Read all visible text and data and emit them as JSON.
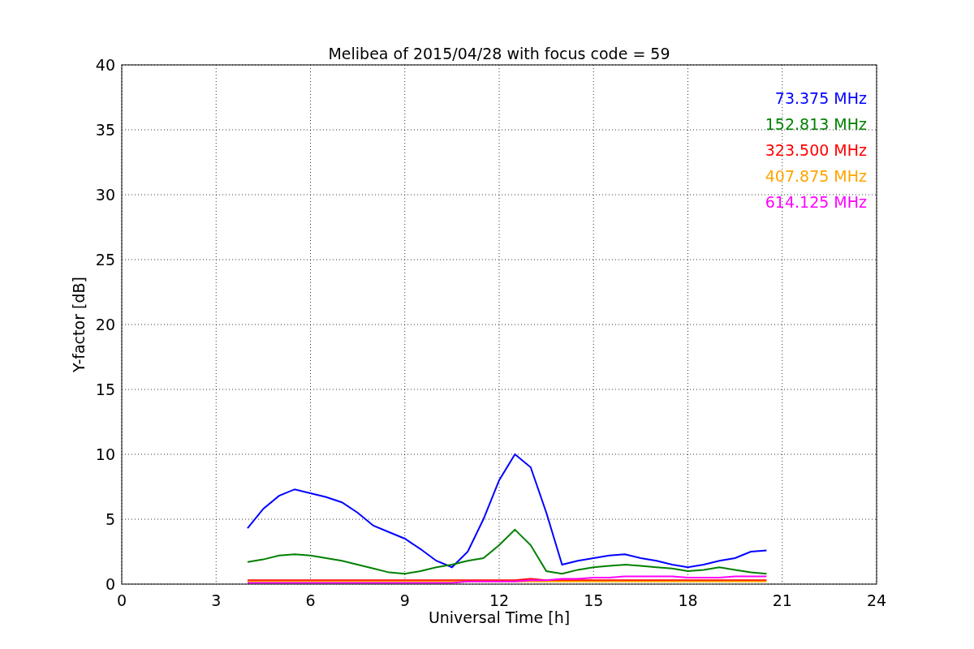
{
  "chart_data": {
    "type": "line",
    "title": "Melibea of 2015/04/28 with focus code = 59",
    "xlabel": "Universal Time [h]",
    "ylabel": "Y-factor [dB]",
    "x": [
      4,
      4.5,
      5,
      5.5,
      6,
      6.5,
      7,
      7.5,
      8,
      8.5,
      9,
      9.5,
      10,
      10.5,
      11,
      11.5,
      12,
      12.5,
      13,
      13.5,
      14,
      14.5,
      15,
      15.5,
      16,
      16.5,
      17,
      17.5,
      18,
      18.5,
      19,
      19.5,
      20,
      20.5
    ],
    "series": [
      {
        "name": "73.375 MHz",
        "color": "#0000ff",
        "values": [
          4.3,
          5.8,
          6.8,
          7.3,
          7.0,
          6.7,
          6.3,
          5.5,
          4.5,
          4.0,
          3.5,
          2.7,
          1.8,
          1.3,
          2.5,
          5.0,
          8.0,
          10.0,
          9.0,
          5.5,
          1.5,
          1.8,
          2.0,
          2.2,
          2.3,
          2.0,
          1.8,
          1.5,
          1.3,
          1.5,
          1.8,
          2.0,
          2.5,
          2.6
        ]
      },
      {
        "name": "152.813 MHz",
        "color": "#008000",
        "values": [
          1.7,
          1.9,
          2.2,
          2.3,
          2.2,
          2.0,
          1.8,
          1.5,
          1.2,
          0.9,
          0.8,
          1.0,
          1.3,
          1.5,
          1.8,
          2.0,
          3.0,
          4.2,
          3.0,
          1.0,
          0.8,
          1.1,
          1.3,
          1.4,
          1.5,
          1.4,
          1.3,
          1.2,
          1.0,
          1.1,
          1.3,
          1.1,
          0.9,
          0.8
        ]
      },
      {
        "name": "323.500 MHz",
        "color": "#ff0000",
        "values": [
          0.3,
          0.3,
          0.3,
          0.3,
          0.3,
          0.3,
          0.3,
          0.3,
          0.3,
          0.3,
          0.3,
          0.3,
          0.3,
          0.3,
          0.3,
          0.3,
          0.3,
          0.3,
          0.4,
          0.3,
          0.3,
          0.3,
          0.3,
          0.3,
          0.3,
          0.3,
          0.3,
          0.3,
          0.3,
          0.3,
          0.3,
          0.3,
          0.3,
          0.3
        ]
      },
      {
        "name": "407.875 MHz",
        "color": "#ffa500",
        "values": [
          0.2,
          0.2,
          0.2,
          0.2,
          0.2,
          0.2,
          0.2,
          0.2,
          0.2,
          0.2,
          0.2,
          0.2,
          0.2,
          0.2,
          0.2,
          0.2,
          0.2,
          0.2,
          0.2,
          0.2,
          0.2,
          0.2,
          0.2,
          0.2,
          0.2,
          0.2,
          0.2,
          0.2,
          0.2,
          0.2,
          0.2,
          0.2,
          0.2,
          0.2
        ]
      },
      {
        "name": "614.125 MHz",
        "color": "#ff00ff",
        "values": [
          0.1,
          0.1,
          0.1,
          0.1,
          0.1,
          0.1,
          0.1,
          0.1,
          0.1,
          0.1,
          0.1,
          0.1,
          0.1,
          0.1,
          0.2,
          0.2,
          0.2,
          0.2,
          0.3,
          0.3,
          0.4,
          0.4,
          0.5,
          0.5,
          0.6,
          0.6,
          0.6,
          0.6,
          0.5,
          0.5,
          0.5,
          0.6,
          0.6,
          0.6
        ]
      }
    ],
    "xlim": [
      0,
      24
    ],
    "ylim": [
      0,
      40
    ],
    "xticks": [
      0,
      3,
      6,
      9,
      12,
      15,
      18,
      21,
      24
    ],
    "yticks": [
      0,
      5,
      10,
      15,
      20,
      25,
      30,
      35,
      40
    ],
    "grid": true
  }
}
